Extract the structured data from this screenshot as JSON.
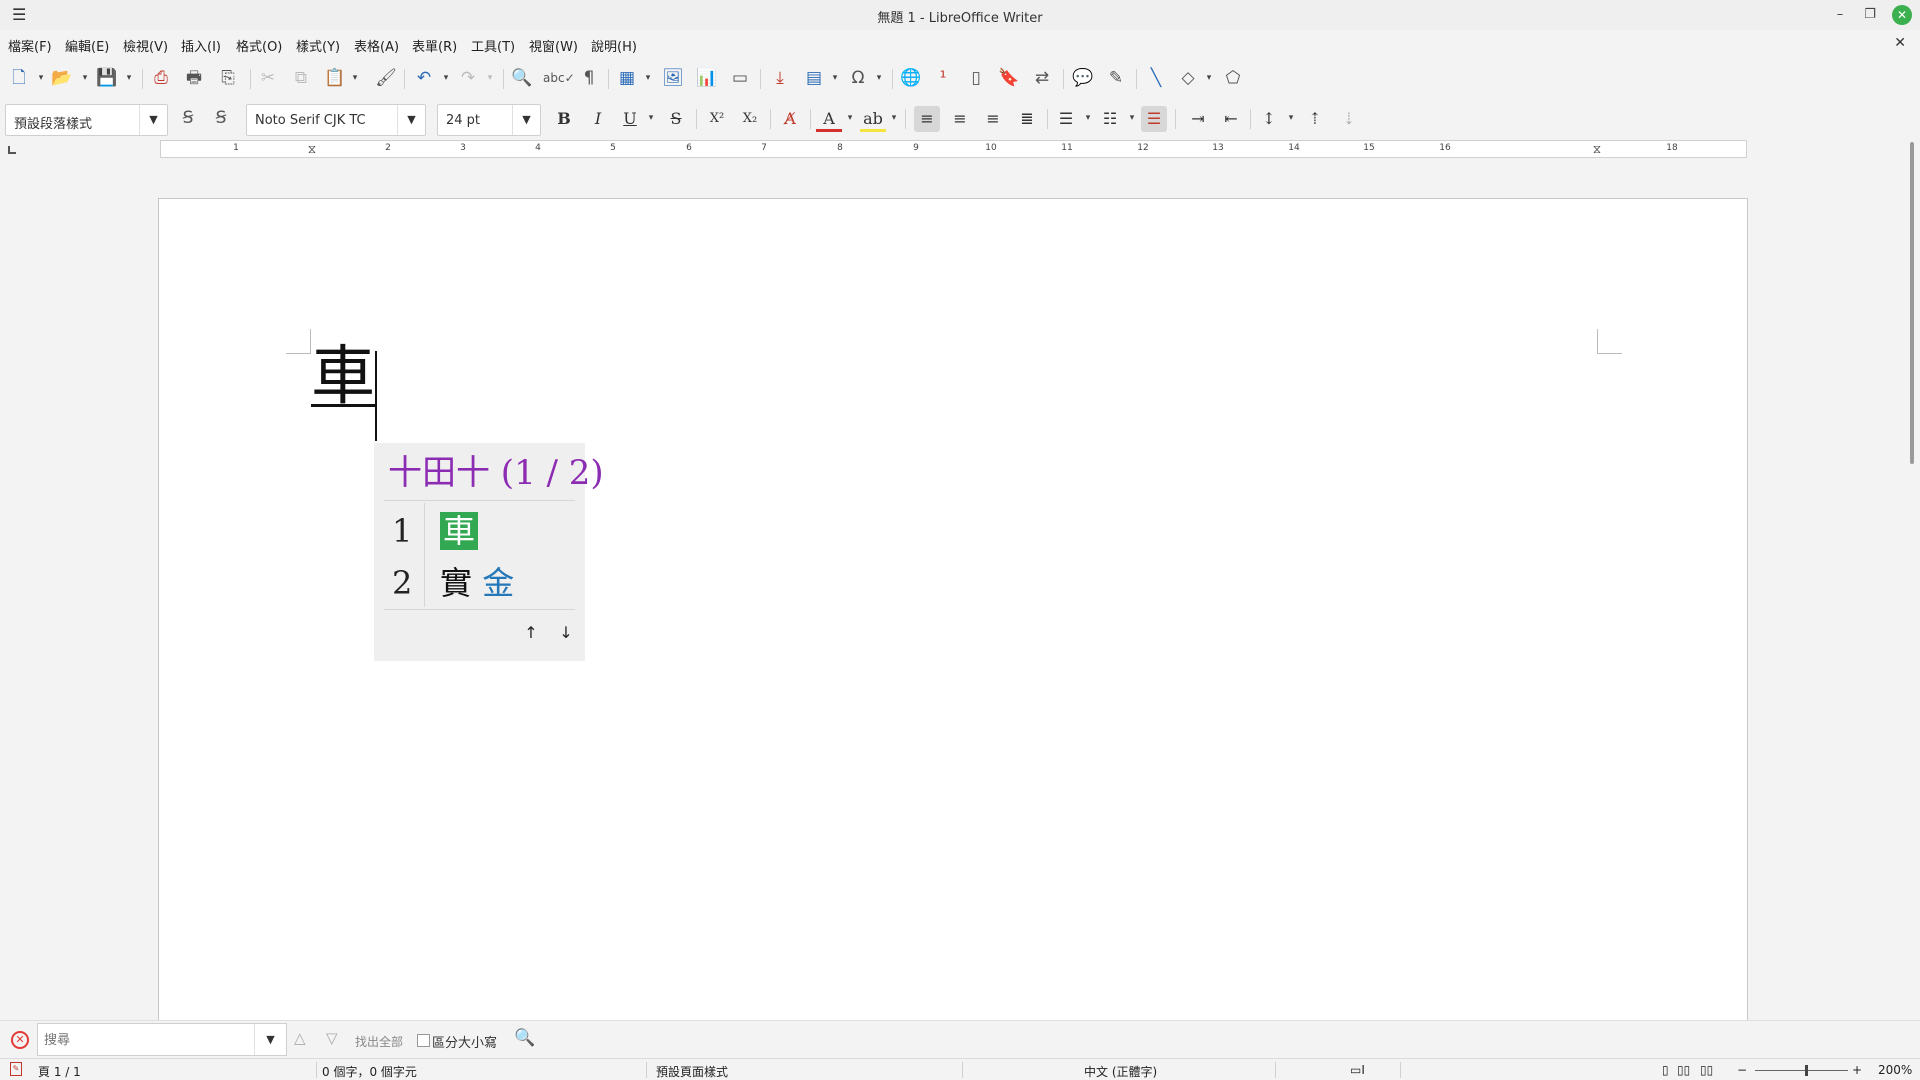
{
  "window": {
    "title": "無題 1 - LibreOffice Writer"
  },
  "menu": [
    "檔案(F)",
    "編輯(E)",
    "檢視(V)",
    "插入(I)",
    "格式(O)",
    "樣式(Y)",
    "表格(A)",
    "表單(R)",
    "工具(T)",
    "視窗(W)",
    "說明(H)"
  ],
  "formatting": {
    "paragraph_style": "預設段落樣式",
    "font_name": "Noto Serif CJK TC",
    "font_size": "24 pt",
    "bold": "B",
    "italic": "I",
    "underline": "U",
    "strikethrough": "S"
  },
  "ruler": {
    "numbers": [
      "1",
      "2",
      "3",
      "4",
      "5",
      "6",
      "7",
      "8",
      "9",
      "10",
      "11",
      "12",
      "13",
      "14",
      "15",
      "16",
      "18"
    ]
  },
  "document": {
    "text": "車"
  },
  "ime": {
    "composition": "十田十 (1 / 2)",
    "candidates": [
      {
        "index": "1",
        "text": "車",
        "hint": ""
      },
      {
        "index": "2",
        "text": "實",
        "hint": "金"
      }
    ],
    "up_arrow": "↑",
    "down_arrow": "↓"
  },
  "findbar": {
    "placeholder": "搜尋",
    "find_all": "找出全部",
    "match_case": "區分大小寫"
  },
  "status": {
    "page": "頁 1 / 1",
    "word_count": "0 個字，0 個字元",
    "page_style": "預設頁面樣式",
    "language": "中文 (正體字)",
    "zoom": "200%"
  },
  "colors": {
    "accent_green": "#33a852",
    "ime_header": "#8b2cb3",
    "hint_blue": "#2477b8",
    "close_green": "#3bb04f"
  }
}
